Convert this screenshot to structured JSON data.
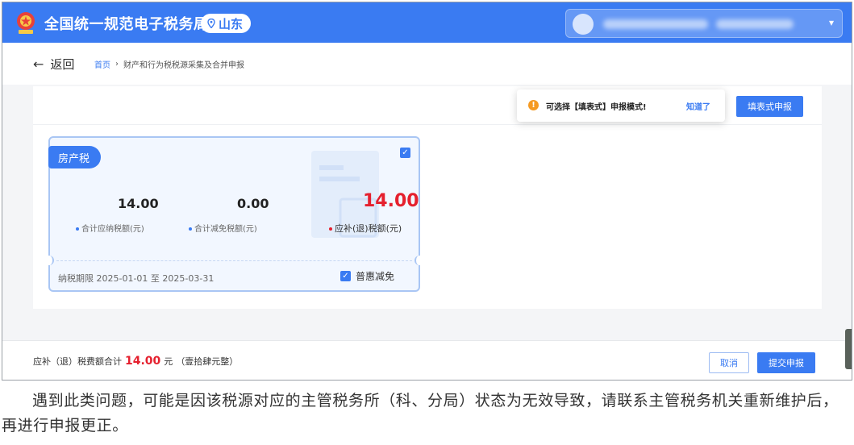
{
  "header": {
    "site_title": "全国统一规范电子税务局",
    "region": "山东",
    "brand_color": "#3a7bf2"
  },
  "nav": {
    "back_label": "返回",
    "breadcrumb": [
      "首页",
      "财产和行为税税源采集及合并申报"
    ]
  },
  "toolbar": {
    "tooltip_text": "可选择【填表式】申报模式!",
    "tooltip_ack": "知道了",
    "fill_form_button": "填表式申报"
  },
  "card": {
    "tax_name": "房产税",
    "total_payable": "14.00",
    "total_payable_label": "合计应纳税额(元)",
    "total_relief": "0.00",
    "total_relief_label": "合计减免税额(元)",
    "due_amount": "14.00",
    "due_label": "应补(退)税额(元)",
    "period": "纳税期限 2025-01-01 至 2025-03-31",
    "relief_option": "普惠减免",
    "selected": true,
    "relief_checked": true
  },
  "footer": {
    "total_label": "应补（退）税费额合计",
    "total_amount": "14.00",
    "total_unit": "元",
    "total_words": "（壹拾肆元整）",
    "cancel_button": "取消",
    "submit_button": "提交申报"
  },
  "caption": "遇到此类问题，可能是因该税源对应的主管税务所（科、分局）状态为无效导致，请联系主管税务机关重新维护后，再进行申报更正。",
  "icons": [
    "emblem-icon",
    "location-pin-icon",
    "avatar",
    "chevron-down-icon",
    "arrow-left-icon",
    "warning-icon",
    "checkbox-checked-icon",
    "document-icon"
  ],
  "colors": {
    "accent": "#3a7bf2",
    "danger": "#e5202e",
    "warning": "#f59a23"
  }
}
